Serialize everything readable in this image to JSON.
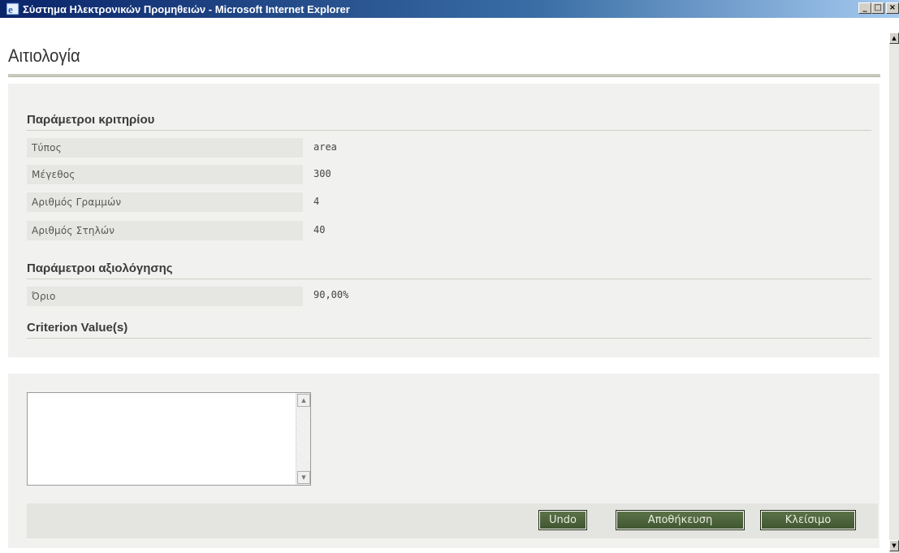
{
  "window": {
    "title": "Σύστημα Ηλεκτρονικών Προμηθειών - Microsoft Internet Explorer",
    "minimize": "_",
    "maximize": "□",
    "close": "×"
  },
  "page": {
    "title": "Αιτιολογία"
  },
  "sections": {
    "criterion_params": {
      "title": "Παράμετροι κριτηρίου",
      "rows": [
        {
          "label": "Τύπος",
          "value": "area"
        },
        {
          "label": "Μέγεθος",
          "value": "300"
        },
        {
          "label": "Αριθμός Γραμμών",
          "value": "4"
        },
        {
          "label": "Αριθμός Στηλών",
          "value": "40"
        }
      ]
    },
    "evaluation_params": {
      "title": "Παράμετροι αξιολόγησης",
      "rows": [
        {
          "label": "Όριο",
          "value": "90,00%"
        }
      ]
    },
    "criterion_values": {
      "title": "Criterion Value(s)"
    }
  },
  "justification": {
    "value": ""
  },
  "buttons": {
    "undo": "Undo",
    "save": "Αποθήκευση",
    "close": "Κλείσιμο"
  },
  "colors": {
    "button_green": "#4d6440",
    "panel_bg": "#f1f1ef",
    "title_bar": "#0a246a"
  }
}
